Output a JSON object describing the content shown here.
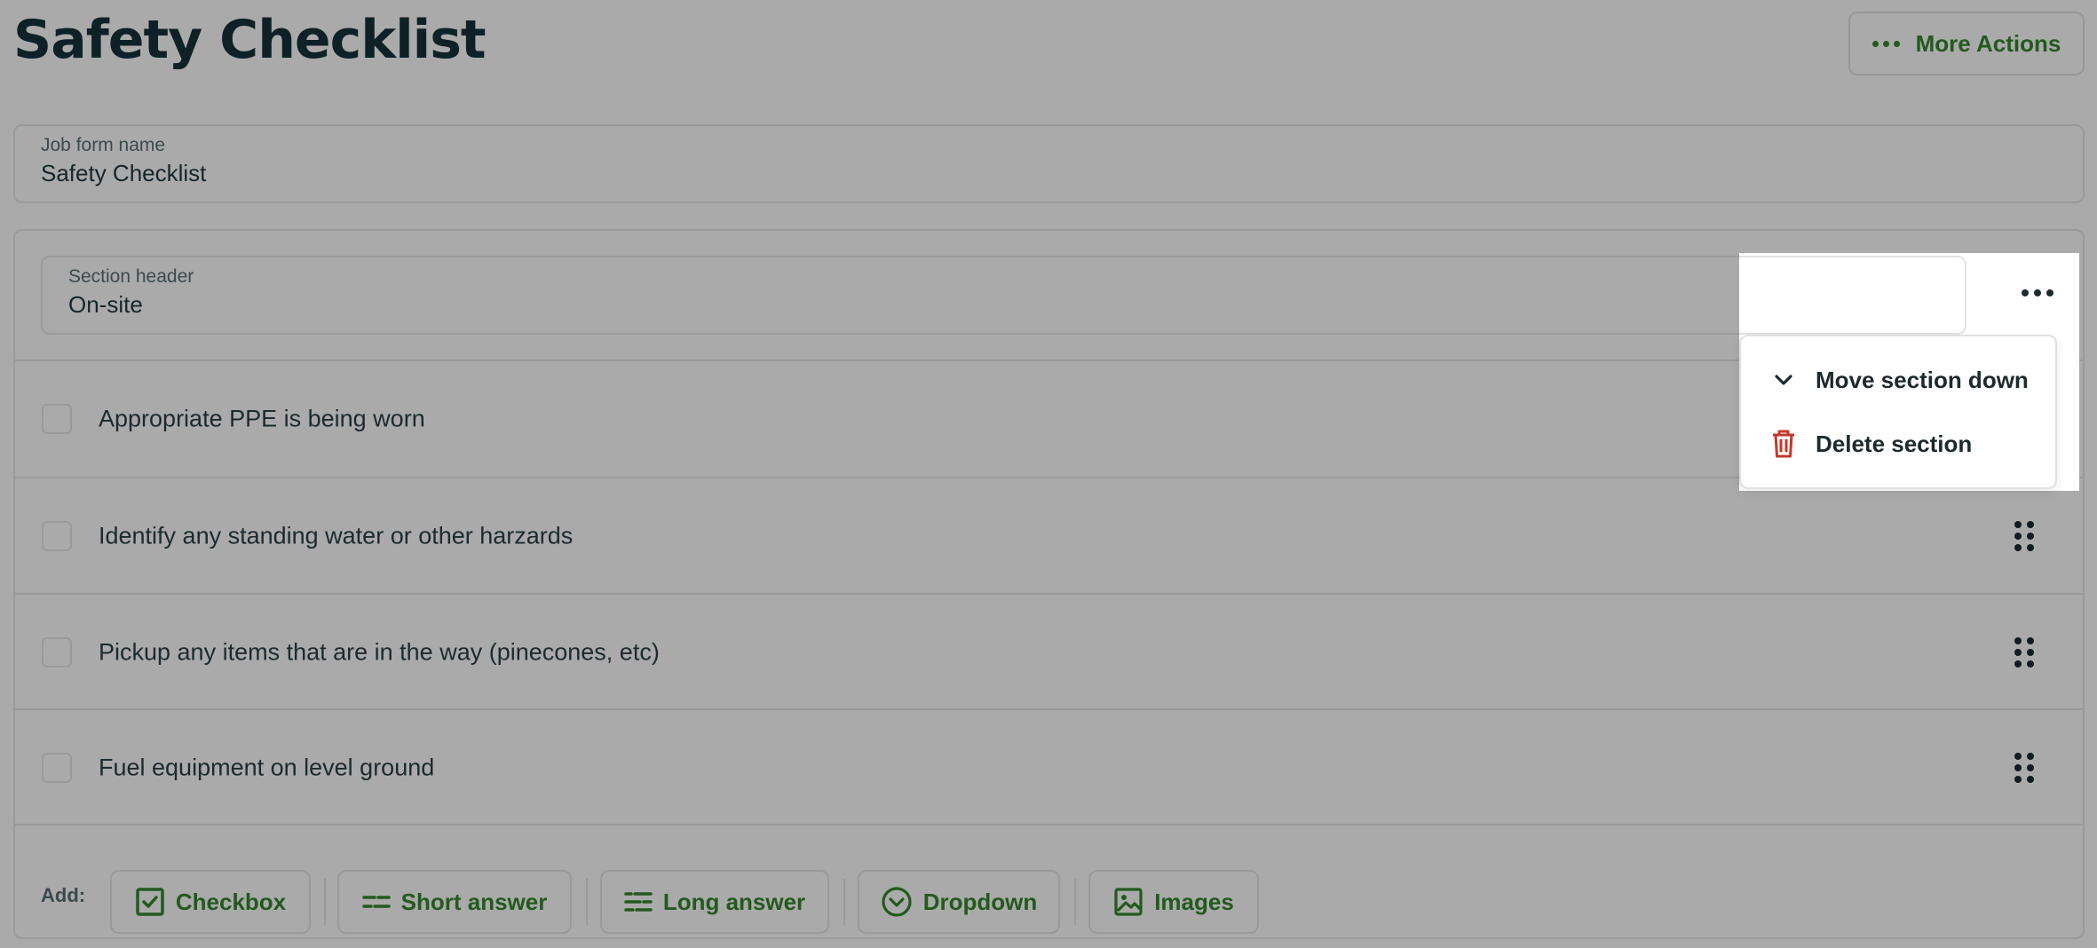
{
  "header": {
    "title": "Safety Checklist",
    "more_actions_label": "More Actions"
  },
  "form_name": {
    "label": "Job form name",
    "value": "Safety Checklist"
  },
  "section": {
    "header_label": "Section header",
    "header_value": "On-site",
    "items": [
      {
        "label": "Appropriate PPE is being worn"
      },
      {
        "label": "Identify any standing water or other harzards"
      },
      {
        "label": "Pickup any items that are in the way (pinecones, etc)"
      },
      {
        "label": "Fuel equipment on level ground"
      }
    ]
  },
  "add_bar": {
    "label": "Add:",
    "buttons": [
      "Checkbox",
      "Short answer",
      "Long answer",
      "Dropdown",
      "Images"
    ]
  },
  "section_menu": {
    "items": [
      {
        "label": "Move section down",
        "icon": "chevron-down-icon"
      },
      {
        "label": "Delete section",
        "icon": "trash-icon"
      }
    ]
  },
  "colors": {
    "overlay_bg": "#aaaaaa",
    "accent_green": "#225a1d",
    "danger_red": "#c0392b",
    "menu_bg": "#ffffff"
  }
}
